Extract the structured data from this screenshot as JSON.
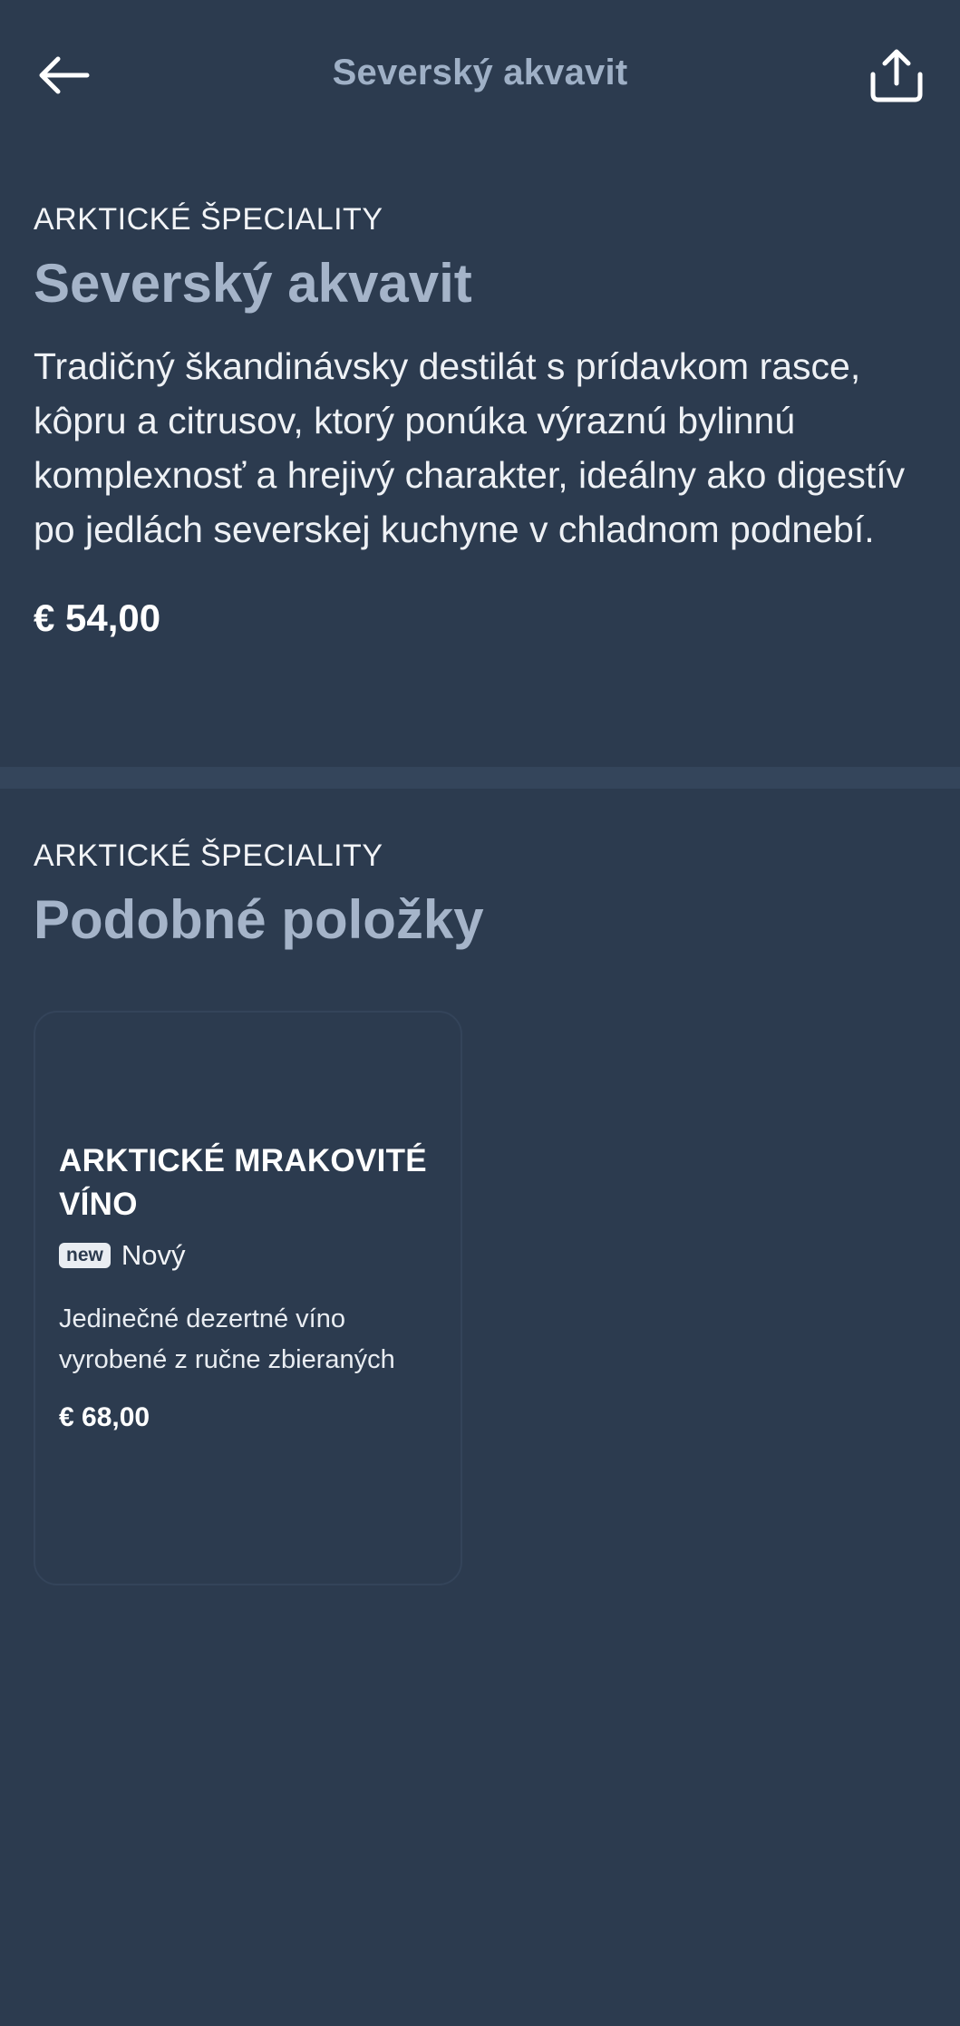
{
  "header": {
    "title": "Severský akvavit",
    "back_icon": "arrow-left-icon",
    "share_icon": "share-icon"
  },
  "product": {
    "category": "ARKTICKÉ ŠPECIALITY",
    "name": "Severský akvavit",
    "description": "Tradičný škandinávsky destilát s prídavkom rasce, kôpru a citrusov, ktorý ponúka výraznú bylinnú komplexnosť a hrejivý charakter, ideálny ako digestív po jedlách severskej kuchyne v chladnom podnebí.",
    "price": "€ 54,00"
  },
  "similar": {
    "category": "ARKTICKÉ ŠPECIALITY",
    "title": "Podobné položky",
    "items": [
      {
        "name": "ARKTICKÉ MRAKOVITÉ VÍNO",
        "badge": "new",
        "badge_label": "Nový",
        "description": "Jedinečné dezertné víno vyrobené z ručne zbieraných",
        "price": "€ 68,00"
      }
    ]
  },
  "colors": {
    "background": "#2c3b4f",
    "accent_title": "#a5b4c9",
    "divider": "#34455b"
  }
}
